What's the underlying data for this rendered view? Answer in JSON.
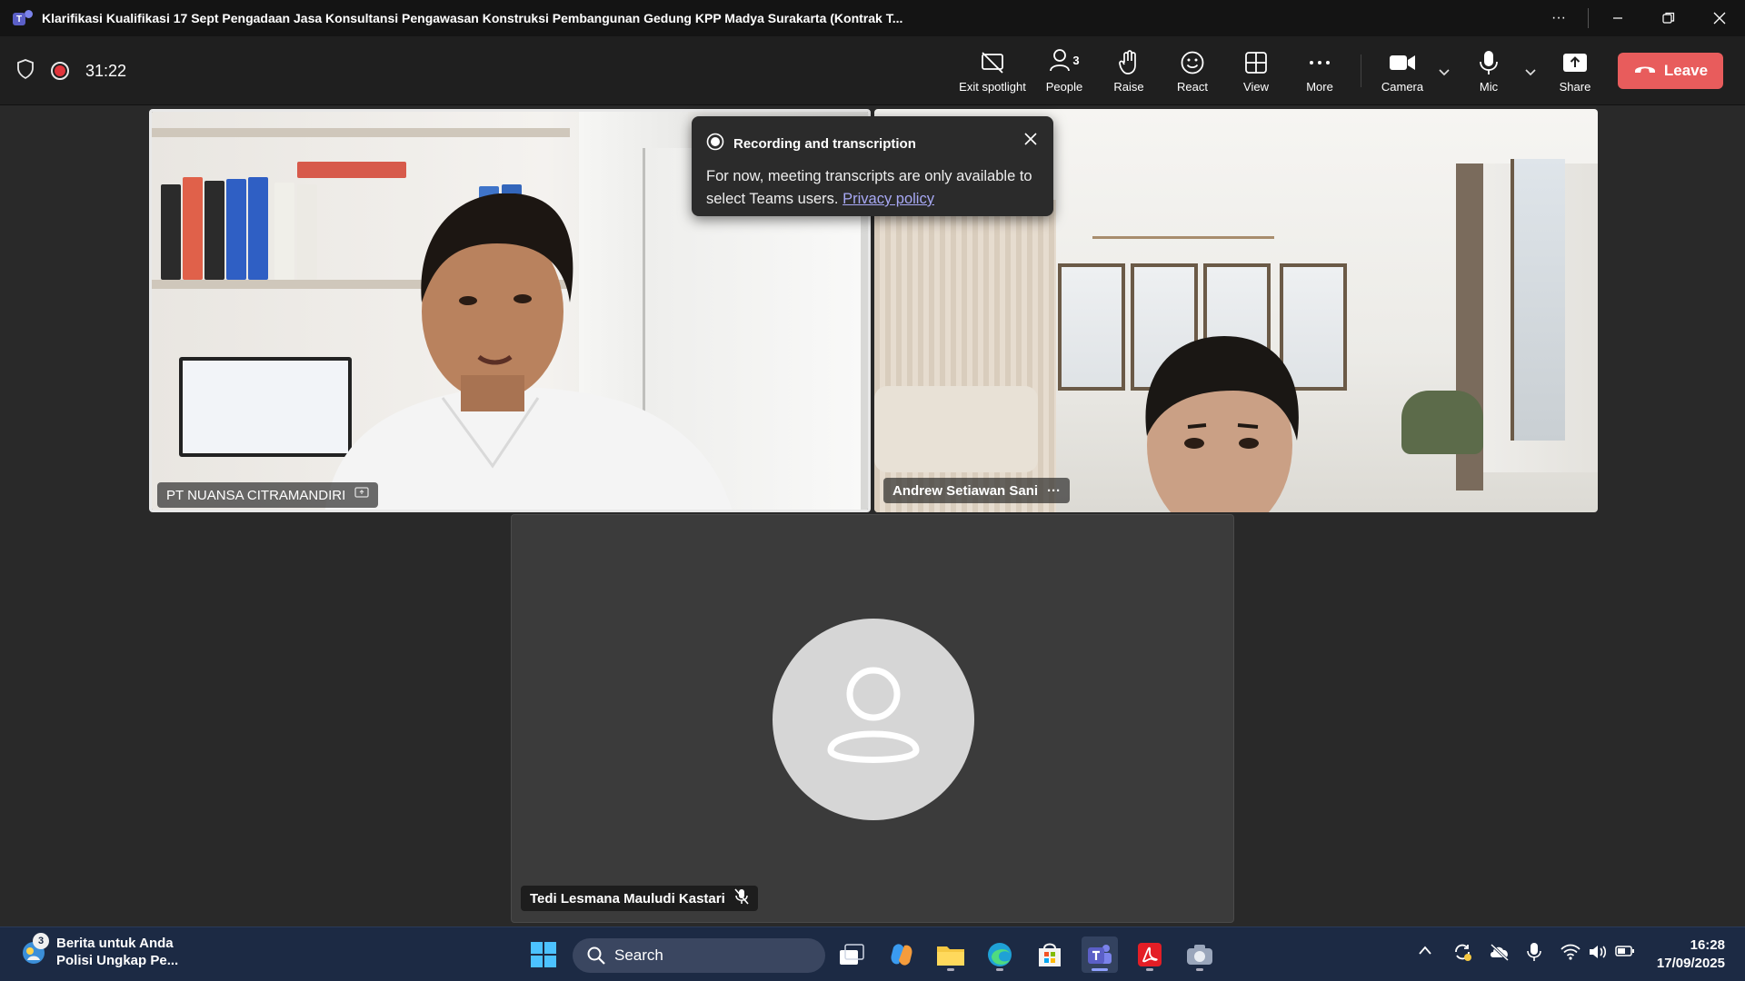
{
  "window": {
    "title": "Klarifikasi Kualifikasi 17 Sept Pengadaan Jasa Konsultansi Pengawasan Konstruksi Pembangunan Gedung KPP Madya Surakarta (Kontrak T...",
    "controls": [
      "more-options",
      "minimize",
      "restore",
      "close"
    ]
  },
  "meeting": {
    "timer": "31:22",
    "toolbar": {
      "exit_spotlight": "Exit spotlight",
      "people": "People",
      "people_count": "3",
      "raise": "Raise",
      "react": "React",
      "view": "View",
      "more": "More",
      "camera": "Camera",
      "mic": "Mic",
      "share": "Share",
      "leave": "Leave"
    },
    "colors": {
      "leave": "#e85c5c",
      "recording": "#e0343b",
      "link": "#a8a9f5"
    }
  },
  "popup": {
    "title": "Recording and transcription",
    "body": "For now, meeting transcripts are only available to select Teams users.",
    "link": "Privacy policy"
  },
  "participants": [
    {
      "name": "PT NUANSA CITRAMANDIRI",
      "spotlighted": true
    },
    {
      "name": "Andrew Setiawan Sani",
      "more": "···"
    },
    {
      "name": "Tedi Lesmana Mauludi Kastari",
      "muted": true
    }
  ],
  "taskbar": {
    "news_badge": "3",
    "news_line1": "Berita untuk Anda",
    "news_line2": "Polisi Ungkap Pe...",
    "search_label": "Search",
    "time": "16:28",
    "date": "17/09/2025",
    "apps": [
      "start",
      "search",
      "task-view",
      "copilot",
      "file-explorer",
      "edge",
      "microsoft-store",
      "teams",
      "acrobat",
      "camera"
    ]
  }
}
